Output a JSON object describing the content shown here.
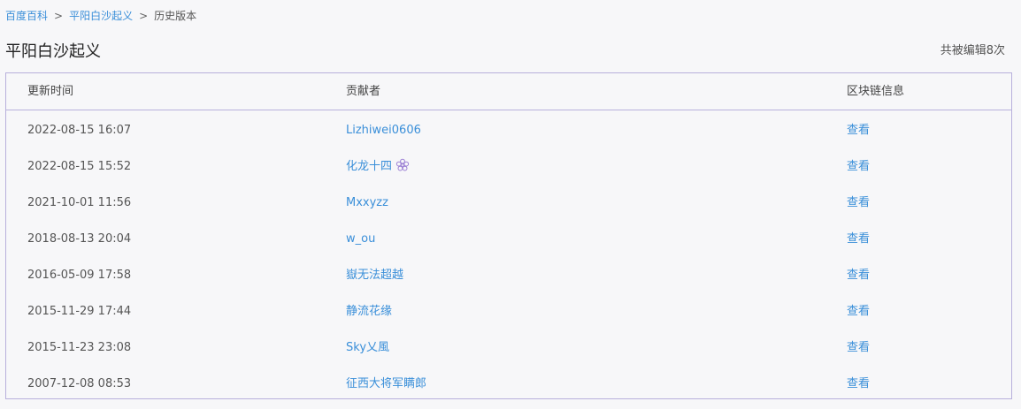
{
  "breadcrumb": {
    "home": "百度百科",
    "entry": "平阳白沙起义",
    "current": "历史版本",
    "separator": ">"
  },
  "page": {
    "title": "平阳白沙起义",
    "edit_count": "共被编辑8次"
  },
  "table": {
    "headers": {
      "time": "更新时间",
      "contributor": "贡献者",
      "chain": "区块链信息"
    },
    "rows": [
      {
        "time": "2022-08-15 16:07",
        "contributor": "Lizhiwei0606",
        "chain": "查看",
        "badge": false
      },
      {
        "time": "2022-08-15 15:52",
        "contributor": "化龙十四",
        "chain": "查看",
        "badge": true
      },
      {
        "time": "2021-10-01 11:56",
        "contributor": "Mxxyzz",
        "chain": "查看",
        "badge": false
      },
      {
        "time": "2018-08-13 20:04",
        "contributor": "w_ou",
        "chain": "查看",
        "badge": false
      },
      {
        "time": "2016-05-09 17:58",
        "contributor": "嶽无法超越",
        "chain": "查看",
        "badge": false
      },
      {
        "time": "2015-11-29 17:44",
        "contributor": "静流花缘",
        "chain": "查看",
        "badge": false
      },
      {
        "time": "2015-11-23 23:08",
        "contributor": "Sky乂風",
        "chain": "查看",
        "badge": false
      },
      {
        "time": "2007-12-08 08:53",
        "contributor": "征西大将军瞒郎",
        "chain": "查看",
        "badge": false
      }
    ]
  },
  "colors": {
    "link": "#3a8fd9",
    "border": "#b8b0dc",
    "badge": "#9b7fd4"
  },
  "icons": {
    "badge": "flower-badge-icon"
  }
}
